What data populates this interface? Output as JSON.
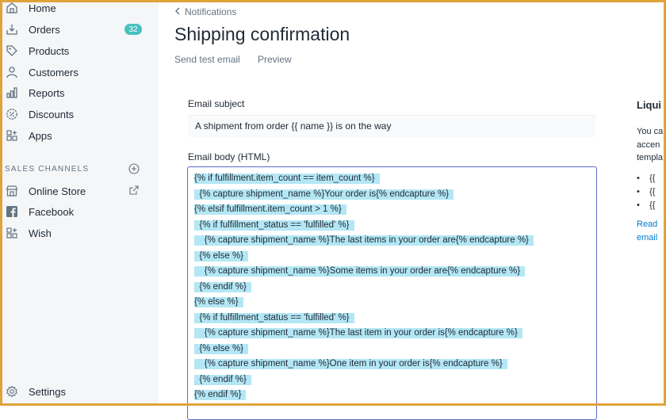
{
  "sidebar": {
    "items": [
      {
        "label": "Home",
        "icon": "home-icon"
      },
      {
        "label": "Orders",
        "icon": "orders-icon",
        "badge": "32"
      },
      {
        "label": "Products",
        "icon": "tag-icon"
      },
      {
        "label": "Customers",
        "icon": "person-icon"
      },
      {
        "label": "Reports",
        "icon": "bar-chart-icon"
      },
      {
        "label": "Discounts",
        "icon": "discount-icon"
      },
      {
        "label": "Apps",
        "icon": "apps-icon"
      }
    ],
    "section_title": "SALES CHANNELS",
    "channels": [
      {
        "label": "Online Store",
        "icon": "store-icon"
      },
      {
        "label": "Facebook",
        "icon": "facebook-icon"
      },
      {
        "label": "Wish",
        "icon": "apps-icon"
      }
    ],
    "settings_label": "Settings",
    "badge_color": "#47c1bf"
  },
  "header": {
    "breadcrumb": "Notifications",
    "title": "Shipping confirmation",
    "actions": [
      "Send test email",
      "Preview"
    ]
  },
  "form": {
    "subject_label": "Email subject",
    "subject_value": "A shipment from order {{ name }} is on the way",
    "body_label": "Email body (HTML)",
    "body_lines": [
      "{% if fulfillment.item_count == item_count %}",
      "  {% capture shipment_name %}Your order is{% endcapture %}",
      "{% elsif fulfillment.item_count > 1 %}",
      "  {% if fulfillment_status == 'fulfilled' %}",
      "    {% capture shipment_name %}The last items in your order are{% endcapture %}",
      "  {% else %}",
      "    {% capture shipment_name %}Some items in your order are{% endcapture %}",
      "  {% endif %}",
      "{% else %}",
      "  {% if fulfillment_status == 'fulfilled' %}",
      "    {% capture shipment_name %}The last item in your order is{% endcapture %}",
      "  {% else %}",
      "    {% capture shipment_name %}One item in your order is{% endcapture %}",
      "  {% endif %}",
      "{% endif %}"
    ],
    "selection_color": "#b4e7f5",
    "focus_color": "#5c6ac4"
  },
  "liquid_panel": {
    "title": "Liqui",
    "text_lines": [
      "You ca",
      "accen",
      "templa"
    ],
    "bullets": [
      "{{",
      "{{",
      "{{"
    ],
    "link_lines": [
      "Read",
      "email"
    ]
  }
}
